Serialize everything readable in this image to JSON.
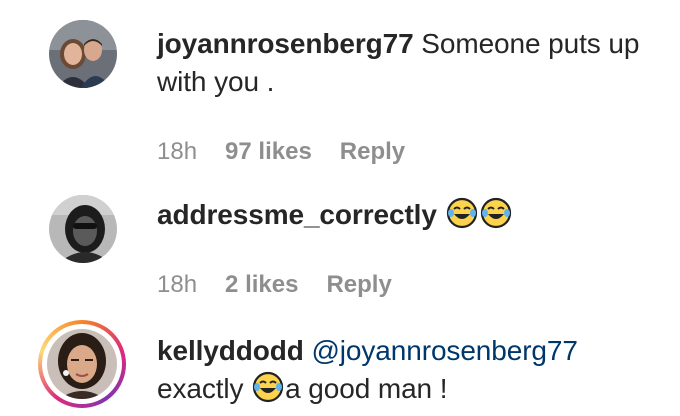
{
  "comments": [
    {
      "username": "joyannrosenberg77",
      "text_line1": "Someone puts up",
      "text_line2": "with you .",
      "time": "18h",
      "likes": "97 likes",
      "reply": "Reply"
    },
    {
      "username": "addressme_correctly",
      "emojis": [
        "joy-emoji",
        "joy-emoji"
      ],
      "time": "18h",
      "likes": "2 likes",
      "reply": "Reply"
    },
    {
      "username": "kellyddodd",
      "mention": "@joyannrosenberg77",
      "text_before_emoji": "exactly",
      "emoji": "joy-emoji",
      "text_after_emoji": "a good man !"
    }
  ],
  "colors": {
    "text": "#262626",
    "meta": "#8e8e8e",
    "mention": "#00376b"
  }
}
